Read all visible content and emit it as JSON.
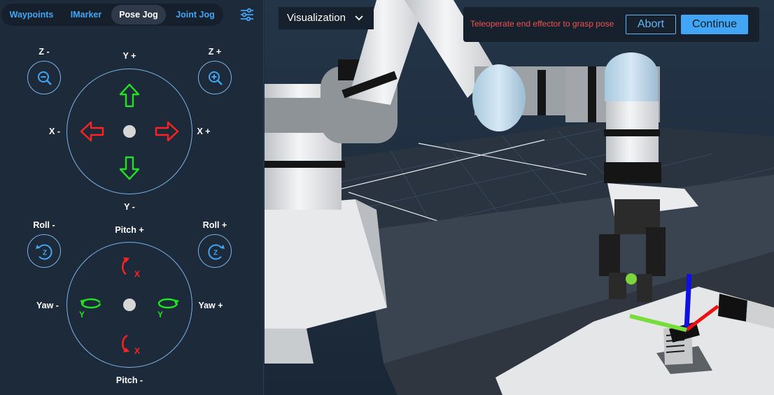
{
  "tabs": [
    {
      "label": "Waypoints",
      "active": false
    },
    {
      "label": "IMarker",
      "active": false
    },
    {
      "label": "Pose Jog",
      "active": true
    },
    {
      "label": "Joint Jog",
      "active": false
    }
  ],
  "settings_icon": "sliders-icon",
  "translation": {
    "z_minus": "Z -",
    "z_plus": "Z +",
    "y_plus": "Y +",
    "y_minus": "Y -",
    "x_minus": "X -",
    "x_plus": "X +"
  },
  "rotation": {
    "roll_minus": "Roll -",
    "roll_plus": "Roll +",
    "pitch_plus": "Pitch +",
    "pitch_minus": "Pitch -",
    "yaw_minus": "Yaw -",
    "yaw_plus": "Yaw +",
    "axis_x": "X",
    "axis_y": "Y",
    "axis_z": "Z"
  },
  "colors": {
    "accent": "#42a5f5",
    "green": "#22e022",
    "red": "#ff2222",
    "prompt": "#ef5350"
  },
  "viewport": {
    "dropdown_value": "Visualization",
    "prompt": "Teleoperate end effector to grasp pose",
    "abort_label": "Abort",
    "continue_label": "Continue"
  }
}
